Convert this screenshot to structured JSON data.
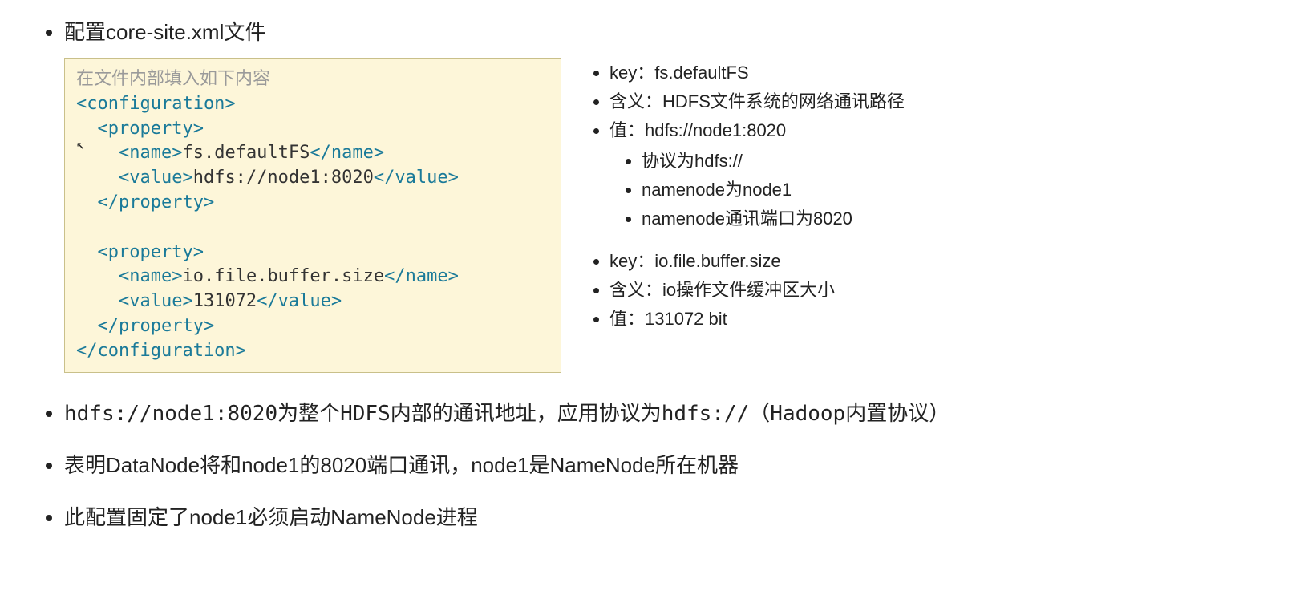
{
  "title": "配置core-site.xml文件",
  "code": {
    "comment": "在文件内部填入如下内容",
    "lines": [
      {
        "indent": 0,
        "type": "tag",
        "text": "<configuration>"
      },
      {
        "indent": 1,
        "type": "tag",
        "text": "<property>"
      },
      {
        "indent": 2,
        "parts": [
          {
            "type": "tag",
            "text": "<name>"
          },
          {
            "type": "text",
            "text": "fs.defaultFS"
          },
          {
            "type": "tag",
            "text": "</name>"
          }
        ]
      },
      {
        "indent": 2,
        "parts": [
          {
            "type": "tag",
            "text": "<value>"
          },
          {
            "type": "text",
            "text": "hdfs://node1:8020"
          },
          {
            "type": "tag",
            "text": "</value>"
          }
        ]
      },
      {
        "indent": 1,
        "type": "tag",
        "text": "</property>"
      },
      {
        "indent": 0,
        "type": "blank",
        "text": ""
      },
      {
        "indent": 1,
        "type": "tag",
        "text": "<property>"
      },
      {
        "indent": 2,
        "parts": [
          {
            "type": "tag",
            "text": "<name>"
          },
          {
            "type": "text",
            "text": "io.file.buffer.size"
          },
          {
            "type": "tag",
            "text": "</name>"
          }
        ]
      },
      {
        "indent": 2,
        "parts": [
          {
            "type": "tag",
            "text": "<value>"
          },
          {
            "type": "text",
            "text": "131072"
          },
          {
            "type": "tag",
            "text": "</value>"
          }
        ]
      },
      {
        "indent": 1,
        "type": "tag",
        "text": "</property>"
      },
      {
        "indent": 0,
        "type": "tag",
        "text": "</configuration>"
      }
    ]
  },
  "notes_block1": {
    "items": [
      "key：fs.defaultFS",
      "含义：HDFS文件系统的网络通讯路径",
      "值：hdfs://node1:8020"
    ],
    "subitems": [
      "协议为hdfs://",
      "namenode为node1",
      "namenode通讯端口为8020"
    ]
  },
  "notes_block2": {
    "items": [
      "key：io.file.buffer.size",
      "含义：io操作文件缓冲区大小",
      "值：131072 bit"
    ]
  },
  "footer": [
    "hdfs://node1:8020为整个HDFS内部的通讯地址，应用协议为hdfs://（Hadoop内置协议）",
    "表明DataNode将和node1的8020端口通讯，node1是NameNode所在机器",
    "此配置固定了node1必须启动NameNode进程"
  ]
}
